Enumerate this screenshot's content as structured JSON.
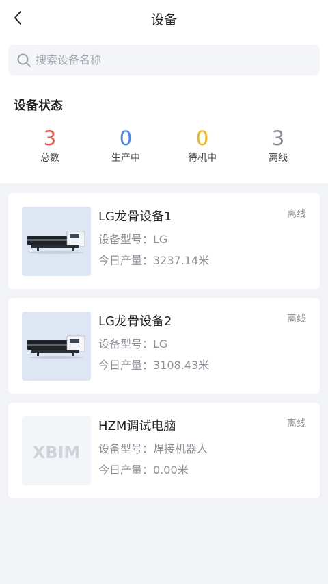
{
  "header": {
    "title": "设备"
  },
  "search": {
    "placeholder": "搜索设备名称",
    "value": ""
  },
  "status_section": {
    "title": "设备状态",
    "stats": [
      {
        "value": "3",
        "label": "总数",
        "color": "#e05a4f"
      },
      {
        "value": "0",
        "label": "生产中",
        "color": "#4a86e8"
      },
      {
        "value": "0",
        "label": "待机中",
        "color": "#f2b21b"
      },
      {
        "value": "3",
        "label": "离线",
        "color": "#8a8c93"
      }
    ]
  },
  "devices": [
    {
      "name": "LG龙骨设备1",
      "model": "设备型号：LG",
      "output": "今日产量：3237.14米",
      "status": "离线",
      "image": "machine"
    },
    {
      "name": "LG龙骨设备2",
      "model": "设备型号：LG",
      "output": "今日产量：3108.43米",
      "status": "离线",
      "image": "machine"
    },
    {
      "name": "HZM调试电脑",
      "model": "设备型号：焊接机器人",
      "output": "今日产量：0.00米",
      "status": "离线",
      "image": "placeholder",
      "placeholder_text": "XBIM"
    }
  ]
}
